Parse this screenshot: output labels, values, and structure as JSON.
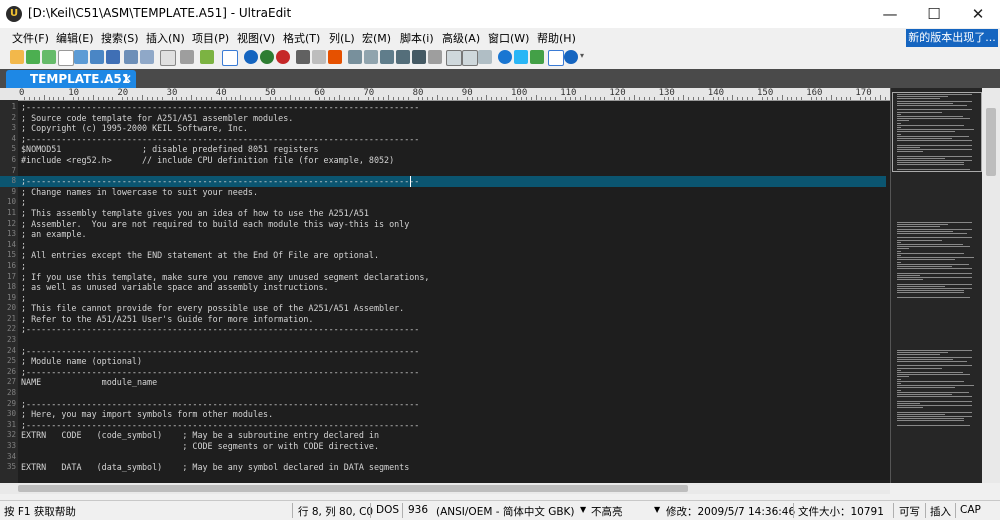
{
  "window": {
    "title": "[D:\\Keil\\C51\\ASM\\TEMPLATE.A51] - UltraEdit",
    "minimize": "—",
    "maximize": "☐",
    "close": "✕"
  },
  "menu": [
    "文件(F)",
    "编辑(E)",
    "搜索(S)",
    "插入(N)",
    "项目(P)",
    "视图(V)",
    "格式(T)",
    "列(L)",
    "宏(M)",
    "脚本(i)",
    "高级(A)",
    "窗口(W)",
    "帮助(H)"
  ],
  "update_button": "新的版本出现了...",
  "tab": {
    "label": "TEMPLATE.A51",
    "close": "✕"
  },
  "ruler": [
    "0",
    "10",
    "20",
    "30",
    "40",
    "50",
    "60",
    "70",
    "80",
    "90",
    "100",
    "110",
    "120",
    "130",
    "140",
    "150",
    "160",
    "170"
  ],
  "code_lines": [
    {
      "n": "1",
      "t": ";------------------------------------------------------------------------------"
    },
    {
      "n": "2",
      "t": "; Source code template for A251/A51 assembler modules."
    },
    {
      "n": "3",
      "t": "; Copyright (c) 1995-2000 KEIL Software, Inc."
    },
    {
      "n": "4",
      "t": ";------------------------------------------------------------------------------"
    },
    {
      "n": "5",
      "t": "$NOMOD51                ; disable predefined 8051 registers"
    },
    {
      "n": "6",
      "t": "#include <reg52.h>      // include CPU definition file (for example, 8052)"
    },
    {
      "n": "7",
      "t": ""
    },
    {
      "n": "8",
      "t": ";------------------------------------------------------------------------------"
    },
    {
      "n": "9",
      "t": "; Change names in lowercase to suit your needs."
    },
    {
      "n": "10",
      "t": ";"
    },
    {
      "n": "11",
      "t": "; This assembly template gives you an idea of how to use the A251/A51"
    },
    {
      "n": "12",
      "t": "; Assembler.  You are not required to build each module this way-this is only"
    },
    {
      "n": "13",
      "t": "; an example."
    },
    {
      "n": "14",
      "t": ";"
    },
    {
      "n": "15",
      "t": "; All entries except the END statement at the End Of File are optional."
    },
    {
      "n": "16",
      "t": ";"
    },
    {
      "n": "17",
      "t": "; If you use this template, make sure you remove any unused segment declarations,"
    },
    {
      "n": "18",
      "t": "; as well as unused variable space and assembly instructions."
    },
    {
      "n": "19",
      "t": ";"
    },
    {
      "n": "20",
      "t": "; This file cannot provide for every possible use of the A251/A51 Assembler."
    },
    {
      "n": "21",
      "t": "; Refer to the A51/A251 User's Guide for more information."
    },
    {
      "n": "22",
      "t": ";------------------------------------------------------------------------------"
    },
    {
      "n": "23",
      "t": ""
    },
    {
      "n": "24",
      "t": ";------------------------------------------------------------------------------"
    },
    {
      "n": "25",
      "t": "; Module name (optional)"
    },
    {
      "n": "26",
      "t": ";------------------------------------------------------------------------------"
    },
    {
      "n": "27",
      "t": "NAME            module_name"
    },
    {
      "n": "28",
      "t": ""
    },
    {
      "n": "29",
      "t": ";------------------------------------------------------------------------------"
    },
    {
      "n": "30",
      "t": "; Here, you may import symbols form other modules."
    },
    {
      "n": "31",
      "t": ";------------------------------------------------------------------------------"
    },
    {
      "n": "32",
      "t": "EXTRN   CODE   (code_symbol)    ; May be a subroutine entry declared in"
    },
    {
      "n": "33",
      "t": "                                ; CODE segments or with CODE directive."
    },
    {
      "n": "34",
      "t": ""
    },
    {
      "n": "35",
      "t": "EXTRN   DATA   (data_symbol)    ; May be any symbol declared in DATA segments"
    }
  ],
  "status": {
    "help": "按 F1 获取帮助",
    "position": "行 8, 列 80, C0",
    "line_ending": "DOS",
    "codepage": "936",
    "encoding": "(ANSI/OEM - 简体中文 GBK)",
    "highlight": "不高亮",
    "modified": "修改：2009/5/7 14:36:46",
    "filesize": "文件大小：10791",
    "mode": "可写",
    "insert": "插入",
    "caps": "CAP"
  },
  "colors": {
    "accent": "#1e88e5",
    "active_line": "#0b5570",
    "editor_bg": "#1e1e1e"
  }
}
